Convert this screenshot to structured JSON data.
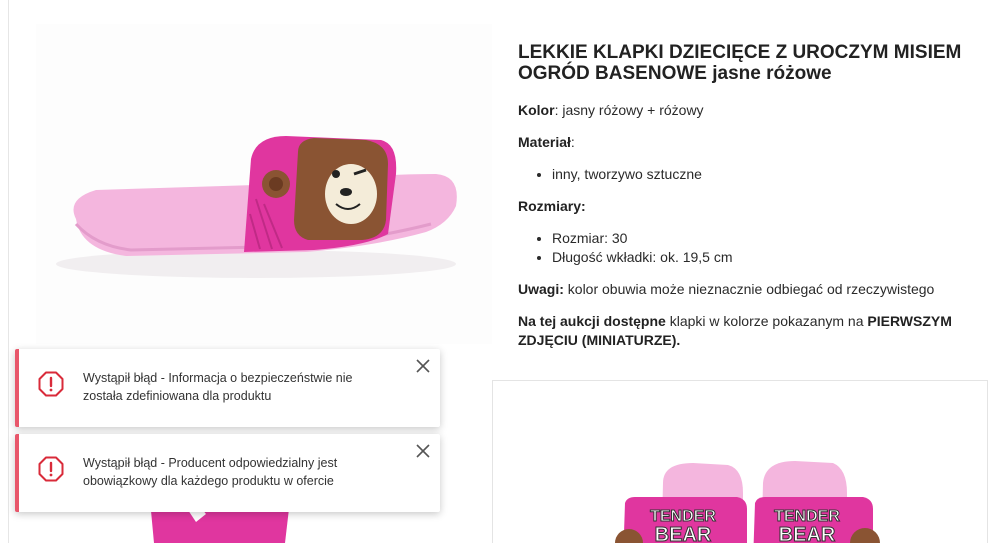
{
  "product": {
    "title_bold": "LEKKIE KLAPKI DZIECIĘCE Z UROCZYM MISIEM OGRÓD BASENOWE",
    "title_rest": "jasne różowe",
    "color_label": "Kolor",
    "color_value": ": jasny różowy + różowy",
    "material_label": "Materiał",
    "material_colon": ":",
    "material_items": [
      "inny, tworzywo sztuczne"
    ],
    "sizes_label": "Rozmiary:",
    "sizes_items": [
      "Rozmiar: 30",
      "Długość wkładki: ok. 19,5 cm"
    ],
    "notes_label": "Uwagi:",
    "notes_value": "kolor obuwia może nieznacznie odbiegać od rzeczywistego",
    "availability_bold": "Na tej aukcji dostępne",
    "availability_text": "klapki w kolorze pokazanym na",
    "availability_bold2": "PIERWSZYM ZDJĘCIU (MINIATURZE).",
    "image_lettering": [
      "TENDER",
      "BEAR",
      "TENDER",
      "BEAR"
    ]
  },
  "toasts": [
    {
      "message": "Wystąpił błąd - Informacja o bezpieczeństwie nie została zdefiniowana dla produktu",
      "icon": "error-circle-icon",
      "close_icon": "close-icon"
    },
    {
      "message": "Wystąpił błąd - Producent odpowiedzialny jest obowiązkowy dla każdego produktu w ofercie",
      "icon": "error-circle-icon",
      "close_icon": "close-icon"
    }
  ],
  "colors": {
    "accent_error": "#e8576b",
    "slipper_pink": "#e0369f",
    "sole_pink": "#f4b6de"
  }
}
